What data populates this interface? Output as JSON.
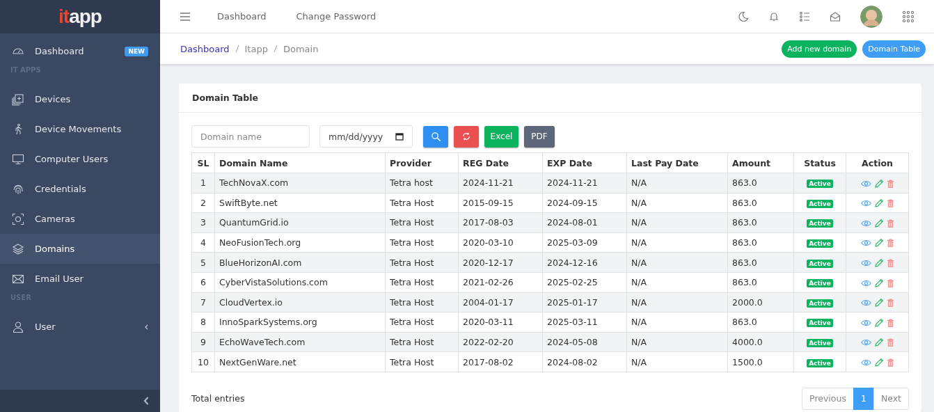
{
  "logo": {
    "accent": "it",
    "rest": "app"
  },
  "sidebar": {
    "items": [
      {
        "kind": "link",
        "label": "Dashboard",
        "badge": "NEW",
        "selected": false
      },
      {
        "kind": "section",
        "label": "IT APPS"
      },
      {
        "kind": "link",
        "label": "Devices",
        "selected": false
      },
      {
        "kind": "link",
        "label": "Device Movements",
        "selected": false
      },
      {
        "kind": "link",
        "label": "Computer Users",
        "selected": false
      },
      {
        "kind": "link",
        "label": "Credentials",
        "selected": false
      },
      {
        "kind": "link",
        "label": "Cameras",
        "selected": false
      },
      {
        "kind": "link",
        "label": "Domains",
        "selected": true
      },
      {
        "kind": "link",
        "label": "Email User",
        "selected": false
      },
      {
        "kind": "section",
        "label": "USER"
      },
      {
        "kind": "link",
        "label": "User",
        "selected": false,
        "expanded": false
      }
    ]
  },
  "topbar": {
    "links": [
      "Dashboard",
      "Change Password"
    ]
  },
  "breadcrumb": [
    {
      "label": "Dashboard",
      "link": true
    },
    {
      "label": "Itapp",
      "link": false
    },
    {
      "label": "Domain",
      "link": false
    }
  ],
  "header_buttons": [
    {
      "label": "Add new domain",
      "kind": "success"
    },
    {
      "label": "Domain Table",
      "kind": "primary"
    }
  ],
  "card": {
    "title": "Domain Table",
    "filters": {
      "name_placeholder": "Domain name",
      "date_placeholder": "mm/dd/yyyy"
    },
    "export_buttons": [
      "Excel",
      "PDF"
    ],
    "table": {
      "columns": [
        "SL",
        "Domain Name",
        "Provider",
        "REG Date",
        "EXP Date",
        "Last Pay Date",
        "Amount",
        "Status",
        "Action"
      ],
      "rows": [
        {
          "sl": "1",
          "domain": "TechNovaX.com",
          "provider": "Tetra host",
          "reg": "2024-11-21",
          "exp": "2024-11-21",
          "last_pay": "N/A",
          "amount": "863.0",
          "status": "Active"
        },
        {
          "sl": "2",
          "domain": "SwiftByte.net",
          "provider": "Tetra Host",
          "reg": "2015-09-15",
          "exp": "2024-09-15",
          "last_pay": "N/A",
          "amount": "863.0",
          "status": "Active"
        },
        {
          "sl": "3",
          "domain": "QuantumGrid.io",
          "provider": "Tetra Host",
          "reg": "2017-08-03",
          "exp": "2024-08-01",
          "last_pay": "N/A",
          "amount": "863.0",
          "status": "Active"
        },
        {
          "sl": "4",
          "domain": "NeoFusionTech.org",
          "provider": "Tetra Host",
          "reg": "2020-03-10",
          "exp": "2025-03-09",
          "last_pay": "N/A",
          "amount": "863.0",
          "status": "Active"
        },
        {
          "sl": "5",
          "domain": "BlueHorizonAI.com",
          "provider": "Tetra Host",
          "reg": "2020-12-17",
          "exp": "2024-12-16",
          "last_pay": "N/A",
          "amount": "863.0",
          "status": "Active"
        },
        {
          "sl": "6",
          "domain": "CyberVistaSolutions.com",
          "provider": "Tetra Host",
          "reg": "2021-02-26",
          "exp": "2025-02-25",
          "last_pay": "N/A",
          "amount": "863.0",
          "status": "Active"
        },
        {
          "sl": "7",
          "domain": "CloudVertex.io",
          "provider": "Tetra Host",
          "reg": "2004-01-17",
          "exp": "2025-01-17",
          "last_pay": "N/A",
          "amount": "2000.0",
          "status": "Active"
        },
        {
          "sl": "8",
          "domain": "InnoSparkSystems.org",
          "provider": "Tetra Host",
          "reg": "2020-03-11",
          "exp": "2025-03-11",
          "last_pay": "N/A",
          "amount": "863.0",
          "status": "Active"
        },
        {
          "sl": "9",
          "domain": "EchoWaveTech.com",
          "provider": "Tetra Host",
          "reg": "2022-02-20",
          "exp": "2024-05-08",
          "last_pay": "N/A",
          "amount": "4000.0",
          "status": "Active"
        },
        {
          "sl": "10",
          "domain": "NextGenWare.net",
          "provider": "Tetra Host",
          "reg": "2017-08-02",
          "exp": "2024-08-02",
          "last_pay": "N/A",
          "amount": "1500.0",
          "status": "Active"
        }
      ]
    },
    "footer": {
      "total_label": "Total entries"
    },
    "pagination": [
      {
        "label": "Previous",
        "selected": false
      },
      {
        "label": "1",
        "selected": true
      },
      {
        "label": "Next",
        "selected": false
      }
    ]
  }
}
